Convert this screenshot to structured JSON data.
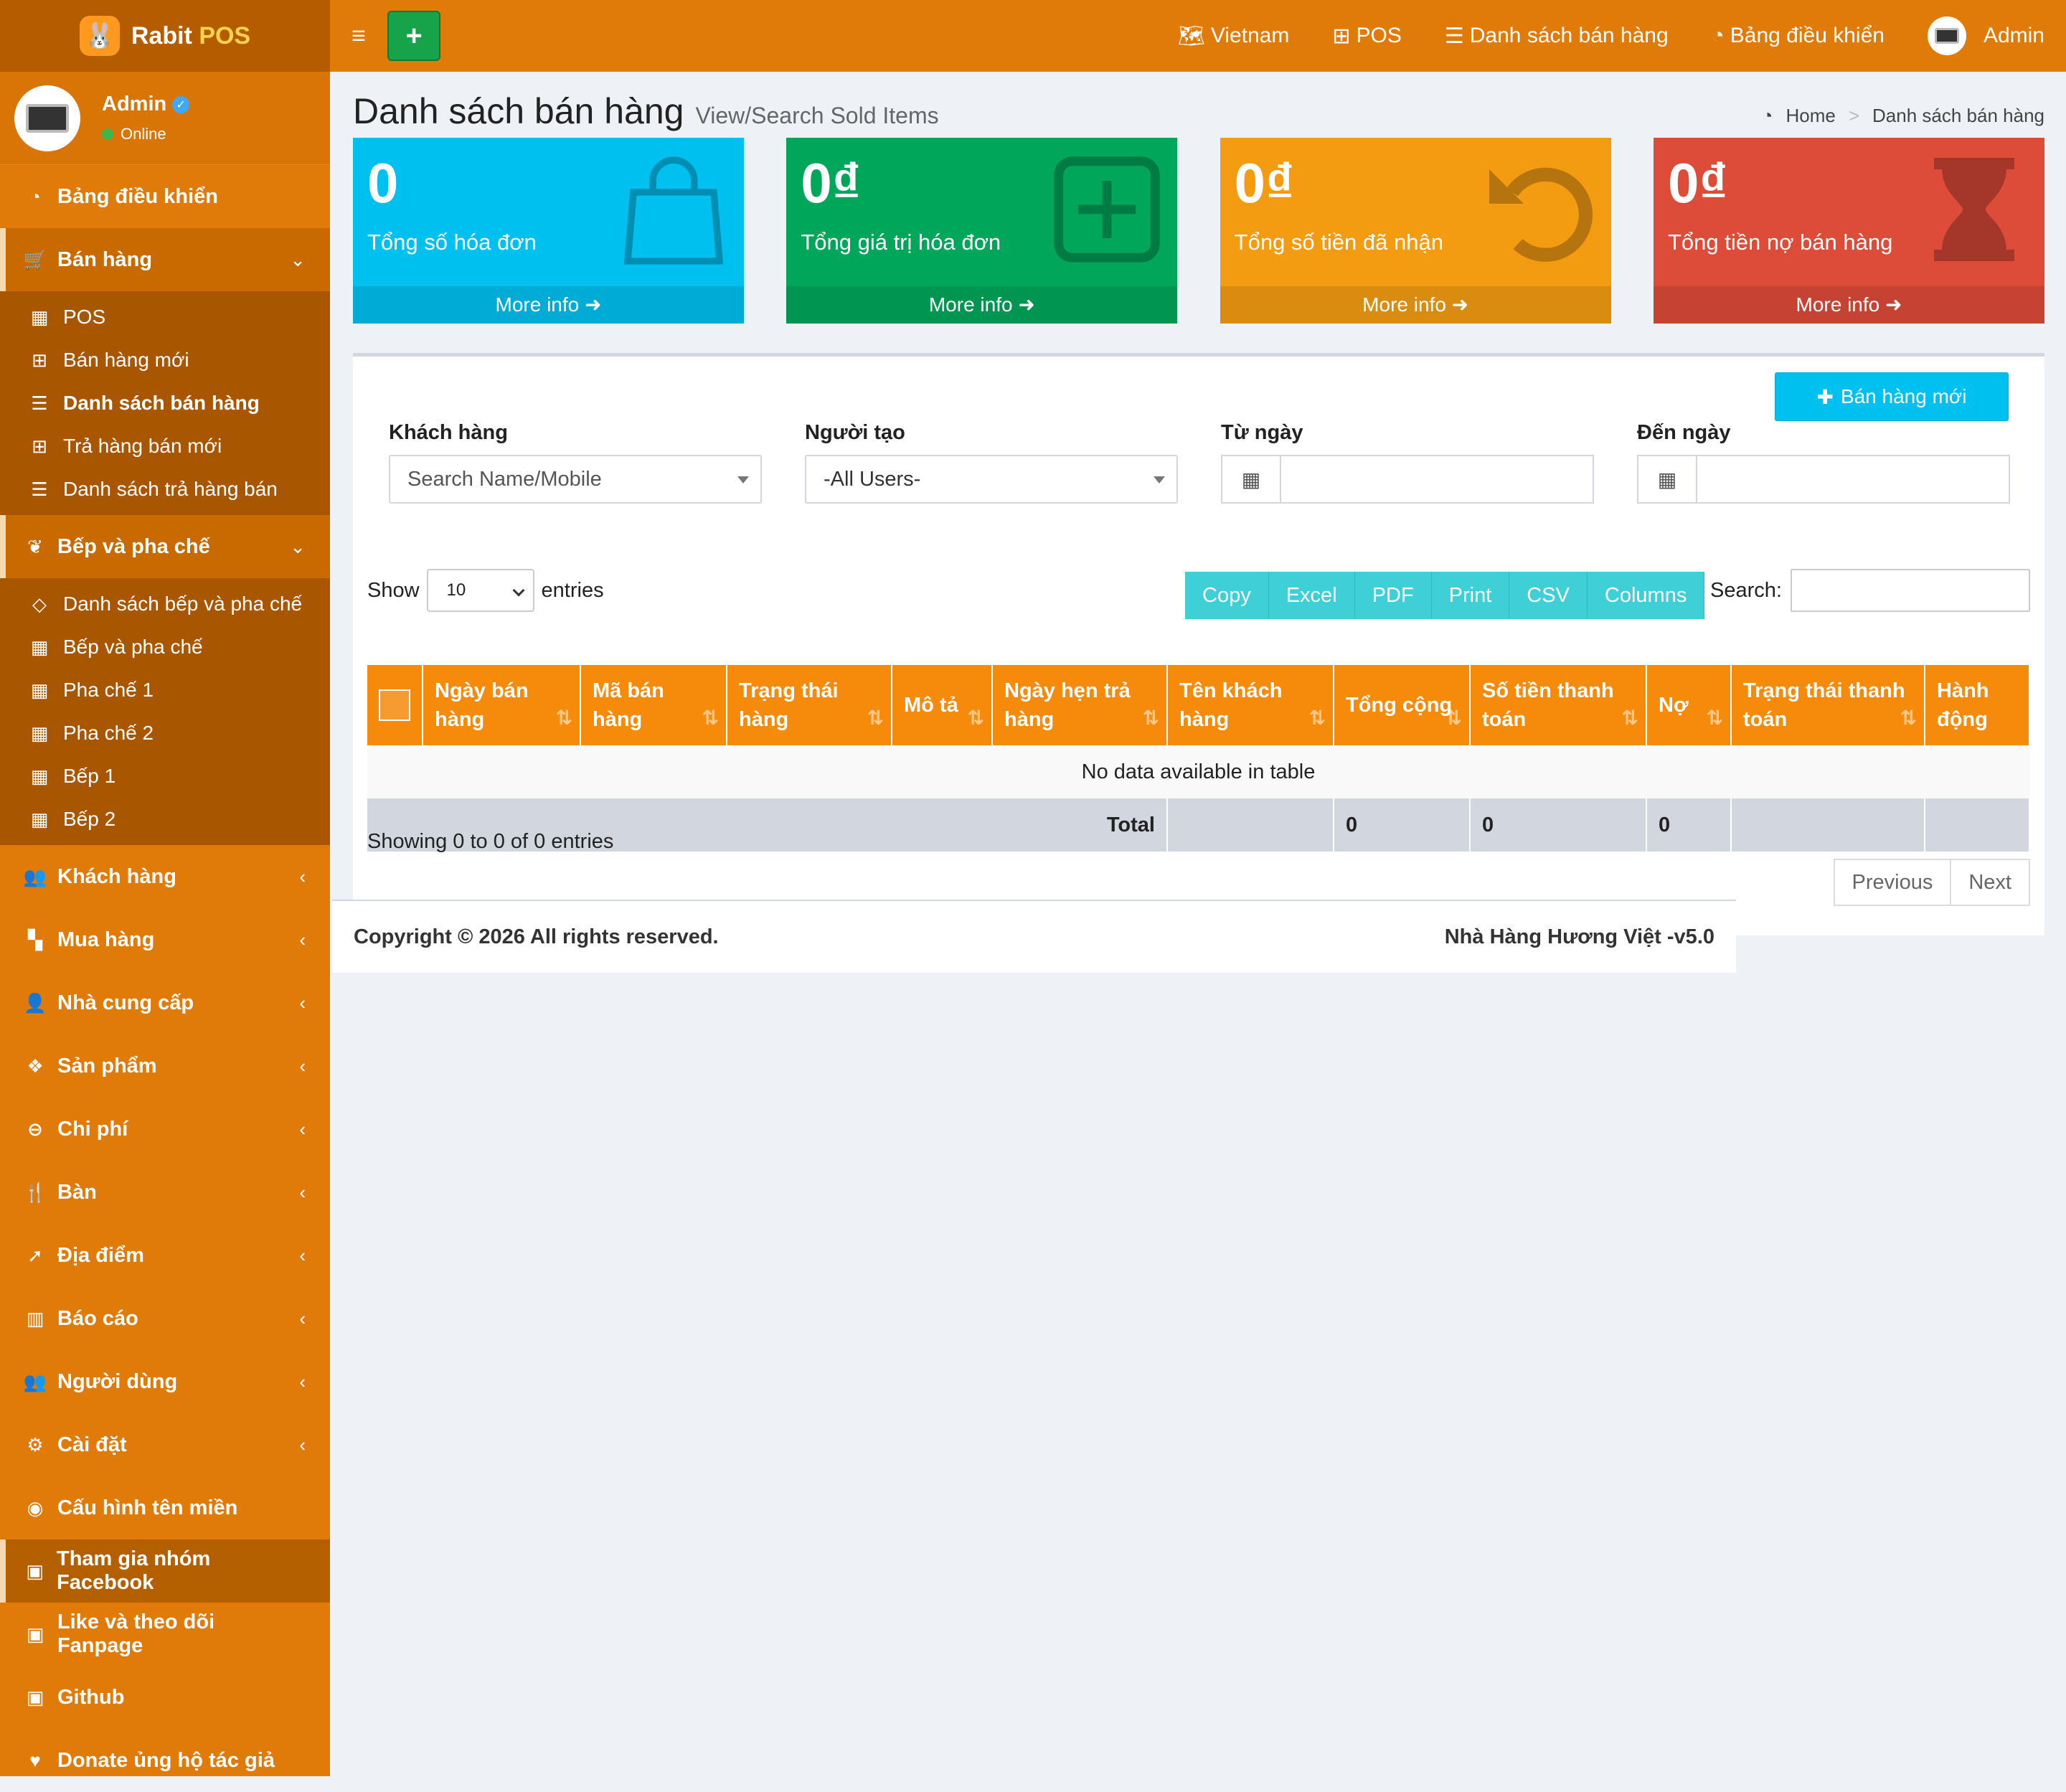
{
  "brand": {
    "name": "Rabit",
    "suffix": "POS"
  },
  "user": {
    "name": "Admin",
    "status": "Online"
  },
  "sidebar": {
    "dashboard": "Bảng điều khiển",
    "sales": {
      "label": "Bán hàng",
      "items": [
        "POS",
        "Bán hàng mới",
        "Danh sách bán hàng",
        "Trả hàng bán mới",
        "Danh sách trả hàng bán"
      ]
    },
    "kitchen": {
      "label": "Bếp và pha chế",
      "items": [
        "Danh sách bếp và pha chế",
        "Bếp và pha chế",
        "Pha chế 1",
        "Pha chế 2",
        "Bếp 1",
        "Bếp 2"
      ]
    },
    "groups": [
      "Khách hàng",
      "Mua hàng",
      "Nhà cung cấp",
      "Sản phẩm",
      "Chi phí",
      "Bàn",
      "Địa điểm",
      "Báo cáo",
      "Người dùng",
      "Cài đặt"
    ],
    "domain": "Cấu hình tên miền",
    "facebook": "Tham gia nhóm Facebook",
    "fanpage": "Like và theo dõi Fanpage",
    "github": "Github",
    "donate": "Donate ủng hộ tác giả"
  },
  "topbar": {
    "language": "Vietnam",
    "pos": "POS",
    "sales_list": "Danh sách bán hàng",
    "dashboard": "Bảng điều khiển",
    "user": "Admin"
  },
  "page": {
    "title": "Danh sách bán hàng",
    "subtitle": "View/Search Sold Items",
    "breadcrumb_home": "Home",
    "breadcrumb_sep": ">",
    "breadcrumb_current": "Danh sách bán hàng"
  },
  "boxes": [
    {
      "value": "0",
      "label": "Tổng số hóa đơn",
      "more": "More info"
    },
    {
      "value": "0₫",
      "label": "Tổng giá trị hóa đơn",
      "more": "More info"
    },
    {
      "value": "0₫",
      "label": "Tổng số tiền đã nhận",
      "more": "More info"
    },
    {
      "value": "0₫",
      "label": "Tổng tiền nợ bán hàng",
      "more": "More info"
    }
  ],
  "new_sale_button": "Bán hàng mới",
  "filters": {
    "customer_label": "Khách hàng",
    "customer_placeholder": "Search Name/Mobile",
    "creator_label": "Người tạo",
    "creator_value": "-All Users-",
    "from_label": "Từ ngày",
    "to_label": "Đến ngày"
  },
  "datatable": {
    "show_label": "Show",
    "length_value": "10",
    "entries_label": "entries",
    "buttons": [
      "Copy",
      "Excel",
      "PDF",
      "Print",
      "CSV",
      "Columns"
    ],
    "search_label": "Search:",
    "columns": [
      "Ngày bán hàng",
      "Mã bán hàng",
      "Trạng thái hàng",
      "Mô tả",
      "Ngày hẹn trả hàng",
      "Tên khách hàng",
      "Tổng cộng",
      "Số tiền thanh toán",
      "Nợ",
      "Trạng thái thanh toán",
      "Hành động"
    ],
    "empty_message": "No data available in table",
    "total_label": "Total",
    "total_sum": "0",
    "total_paid": "0",
    "total_debt": "0",
    "info": "Showing 0 to 0 of 0 entries",
    "previous": "Previous",
    "next": "Next"
  },
  "footer": {
    "copyright": "Copyright © 2026 All rights reserved.",
    "version": "Nhà Hàng Hương Việt -v5.0"
  }
}
